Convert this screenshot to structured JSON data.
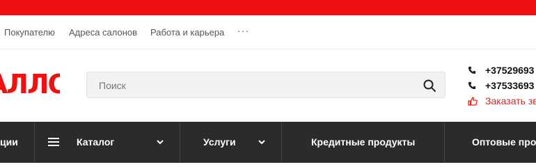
{
  "info_nav": {
    "items": [
      "Покупателю",
      "Адреса салонов",
      "Работа и карьера"
    ],
    "more": "···"
  },
  "logo": {
    "text": "АЛЛО"
  },
  "search": {
    "placeholder": "Поиск",
    "value": ""
  },
  "contacts": {
    "phones": [
      "+37529693",
      "+37533693"
    ],
    "callback": "Заказать зв"
  },
  "main_nav": {
    "items": [
      "ции",
      "Каталог",
      "Услуги",
      "Кредитные продукты",
      "Оптовые про"
    ]
  },
  "colors": {
    "brand_red": "#ee1111",
    "nav_bg": "#2b2b2b",
    "callback_red": "#e0201a"
  },
  "icons": [
    "search-icon",
    "phone-icon",
    "thumbs-up-icon",
    "menu-icon",
    "chevron-down-icon"
  ]
}
